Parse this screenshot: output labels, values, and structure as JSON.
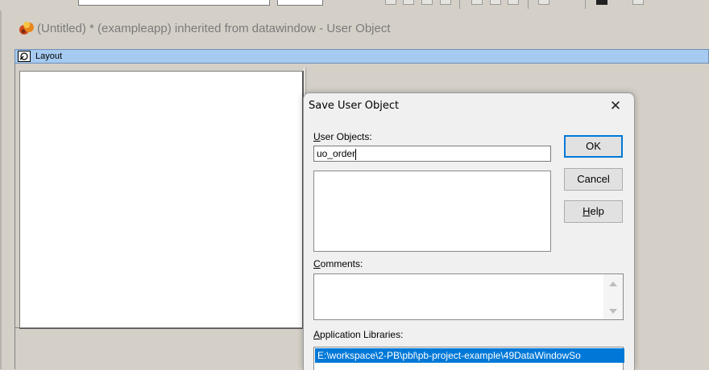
{
  "painter": {
    "title": "(Untitled) * (exampleapp) inherited from datawindow - User Object",
    "layout_label": "Layout"
  },
  "dialog": {
    "title": "Save User Object",
    "close_glyph": "✕",
    "user_objects_label": "User Objects:",
    "user_objects_accesskey": "U",
    "user_objects_rest": "ser Objects:",
    "object_name_value": "uo_order",
    "comments_accesskey": "C",
    "comments_rest": "omments:",
    "comments_value": "",
    "libraries_accesskey": "A",
    "libraries_rest": "pplication Libraries:",
    "libraries": [
      "E:\\workspace\\2-PB\\pbl\\pb-project-example\\49DataWindowSo"
    ],
    "buttons": {
      "ok": "OK",
      "cancel": "Cancel",
      "help_accesskey": "H",
      "help_rest": "elp"
    }
  },
  "icons": {
    "app": "powerbuilder-app-icon",
    "layout": "layout-pane-icon",
    "close": "close-icon"
  },
  "colors": {
    "selection": "#0078d7",
    "layout_bar": "#a6caf0",
    "dialog_bg": "#f0f0f0",
    "face": "#d4d0c8"
  }
}
